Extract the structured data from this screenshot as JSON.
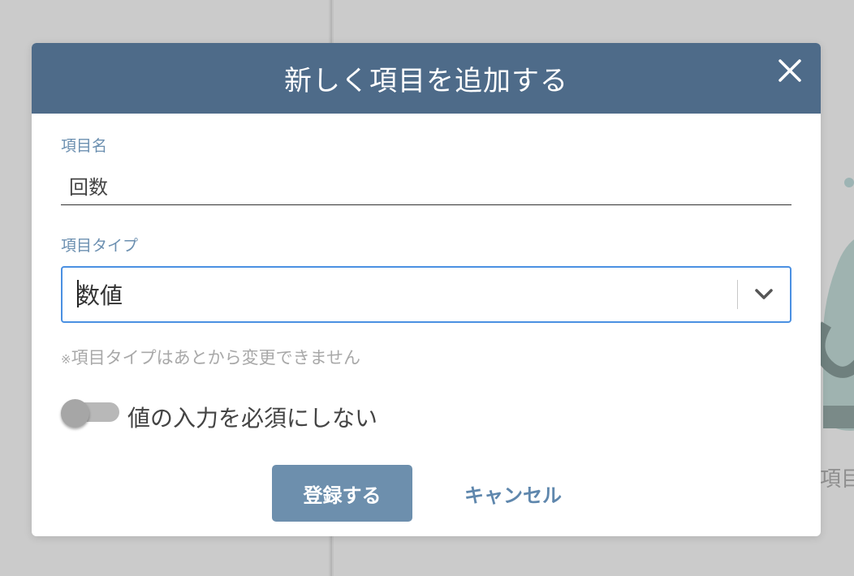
{
  "background": {
    "side_label": "項目"
  },
  "modal": {
    "title": "新しく項目を追加する",
    "close_icon": "close-icon",
    "name_field": {
      "label": "項目名",
      "value": "回数"
    },
    "type_field": {
      "label": "項目タイプ",
      "selected": "数値",
      "arrow_icon": "chevron-down-icon"
    },
    "note": {
      "mark": "※",
      "text": "項目タイプはあとから変更できません"
    },
    "required_toggle": {
      "label": "値の入力を必須にしない",
      "checked": false
    },
    "buttons": {
      "submit": "登録する",
      "cancel": "キャンセル"
    }
  },
  "colors": {
    "header": "#4e6b89",
    "accent": "#4a90e2",
    "submit": "#6d8fad",
    "label": "#6b8fb0",
    "overlay": "#cbcbcb"
  }
}
